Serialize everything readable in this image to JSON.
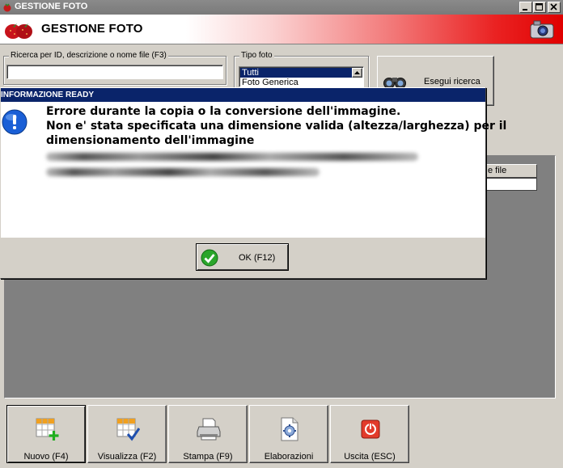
{
  "window": {
    "title": "GESTIONE FOTO"
  },
  "header": {
    "title": "GESTIONE FOTO"
  },
  "search": {
    "label": "Ricerca per ID, descrizione o nome file (F3)",
    "value": ""
  },
  "tipo_foto": {
    "label": "Tipo foto",
    "options": [
      "Tutti",
      "Foto Generica"
    ]
  },
  "search_button": {
    "label": "Esegui ricerca"
  },
  "grid": {
    "column_fragment": "e file"
  },
  "dialog": {
    "title": "INFORMAZIONE READY",
    "line1": "Errore durante la copia o la conversione dell'immagine.",
    "line2": "Non e' stata specificata una dimensione valida (altezza/larghezza) per il",
    "line3": "dimensionamento dell'immagine",
    "ok_label": "OK (F12)"
  },
  "toolbar": {
    "nuovo": "Nuovo (F4)",
    "visualizza": "Visualizza (F2)",
    "stampa": "Stampa (F9)",
    "elaborazioni": "Elaborazioni",
    "uscita": "Uscita (ESC)"
  },
  "colors": {
    "header_red": "#e00000",
    "dialog_title": "#0a246a",
    "info_blue": "#1a5fd6"
  }
}
